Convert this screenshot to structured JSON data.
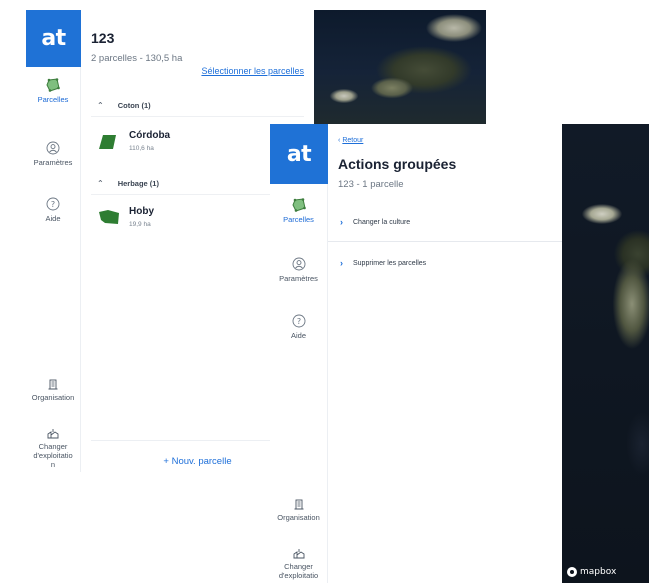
{
  "back": {
    "logo": "at",
    "nav": {
      "parcelles": "Parcelles",
      "parametres": "Paramètres",
      "aide": "Aide",
      "organisation": "Organisation",
      "changer_line1": "Changer",
      "changer_line2": "d'exploitatio",
      "changer_line3": "n"
    },
    "farm_title": "123",
    "farm_subtitle": "2 parcelles  -  130,5 ha",
    "select_link": "Sélectionner les parcelles",
    "groups": [
      {
        "label": "Coton (1)",
        "parcel_name": "Córdoba",
        "parcel_area": "110,6 ha"
      },
      {
        "label": "Herbage (1)",
        "parcel_name": "Hoby",
        "parcel_area": "19,9 ha"
      }
    ],
    "new_parcel": "+ Nouv. parcelle"
  },
  "front": {
    "logo": "at",
    "nav": {
      "parcelles": "Parcelles",
      "parametres": "Paramètres",
      "aide": "Aide",
      "organisation": "Organisation",
      "changer_line1": "Changer",
      "changer_line2": "d'exploitatio"
    },
    "back_link": "Retour",
    "back_chevron": "‹",
    "title": "Actions groupées",
    "subtitle": "123 - 1 parcelle",
    "actions": [
      {
        "label": "Changer la culture"
      },
      {
        "label": "Supprimer les parcelles"
      }
    ],
    "map_attribution": "mapbox"
  },
  "colors": {
    "brand_blue": "#1f72d6",
    "link_blue": "#1e6fd9",
    "parcel_green": "#2e7d32"
  },
  "icons": [
    "parcel-icon",
    "user-circle-icon",
    "help-icon",
    "building-icon",
    "farm-icon",
    "chevron-right-icon",
    "chevron-up-icon",
    "mapbox-logo-icon"
  ]
}
